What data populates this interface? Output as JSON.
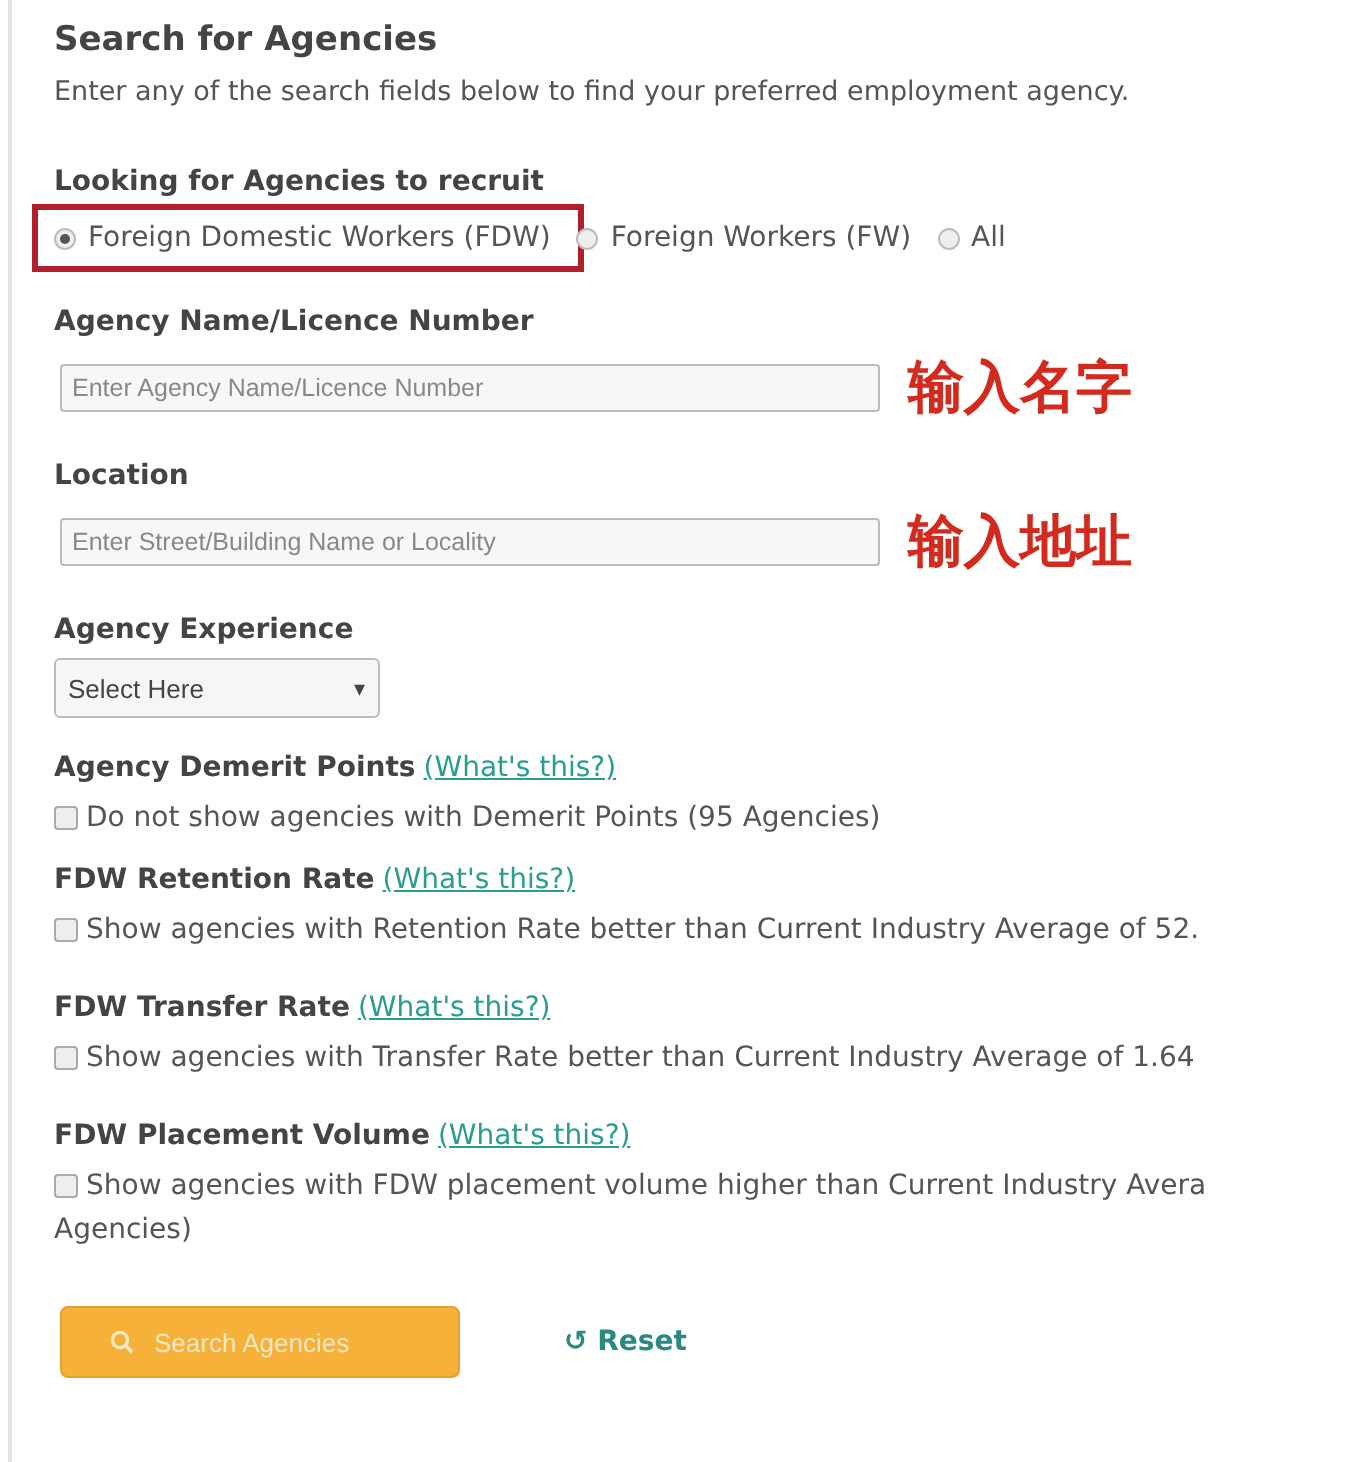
{
  "title": "Search for Agencies",
  "description": "Enter any of the search fields below to find your preferred employment agency.",
  "recruit": {
    "label": "Looking for Agencies to recruit",
    "options": [
      {
        "label": "Foreign Domestic Workers (FDW)",
        "selected": true,
        "highlighted": true
      },
      {
        "label": "Foreign Workers (FW)",
        "selected": false,
        "highlighted": false
      },
      {
        "label": "All",
        "selected": false,
        "highlighted": false
      }
    ]
  },
  "fields": [
    {
      "label": "Agency Name/Licence Number",
      "placeholder": "Enter Agency Name/Licence Number",
      "annotation": "输入名字"
    },
    {
      "label": "Location",
      "placeholder": "Enter Street/Building Name or Locality",
      "annotation": "输入地址"
    }
  ],
  "experience": {
    "label": "Agency Experience",
    "value": "Select Here",
    "caret": "▾"
  },
  "filters": [
    {
      "label": "Agency Demerit Points",
      "link": "(What's this?)",
      "text": "Do not show agencies with Demerit Points (95 Agencies)",
      "checked": false
    },
    {
      "label": "FDW Retention Rate",
      "link": "(What's this?)",
      "text": "Show agencies with Retention Rate better than Current Industry Average of 52.",
      "checked": false
    },
    {
      "label": "FDW Transfer Rate",
      "link": "(What's this?)",
      "text": "Show agencies with Transfer Rate better than Current Industry Average of 1.64",
      "checked": false
    },
    {
      "label": "FDW Placement Volume",
      "link": "(What's this?)",
      "text": "Show agencies with FDW placement volume higher than Current Industry Avera",
      "continuation": "Agencies)",
      "checked": false
    }
  ],
  "search_button": "Search Agencies",
  "reset_button": {
    "icon": "↺",
    "label": "Reset"
  }
}
